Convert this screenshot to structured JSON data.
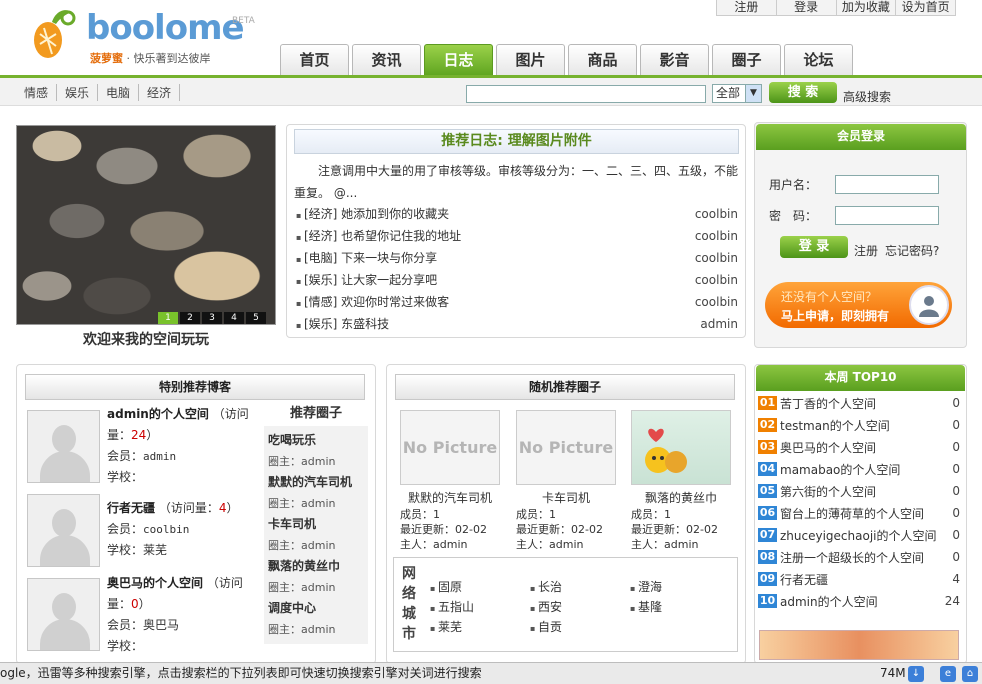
{
  "brand": {
    "name": "boolome",
    "beta": "BETA",
    "slogan_name": "菠萝蜜",
    "slogan_rest": " · 快乐著到达彼岸"
  },
  "toplinks": [
    "注册",
    "登录",
    "加为收藏",
    "设为首页"
  ],
  "tabs": [
    "首页",
    "资讯",
    "日志",
    "图片",
    "商品",
    "影音",
    "圈子",
    "论坛"
  ],
  "active_tab": "日志",
  "subnav": [
    "情感",
    "娱乐",
    "电脑",
    "经济"
  ],
  "search": {
    "select_value": "全部",
    "button": "搜 索",
    "advanced": "高级搜索"
  },
  "slideshow": {
    "pages": [
      "1",
      "2",
      "3",
      "4",
      "5"
    ],
    "active": "1",
    "caption": "欢迎来我的空间玩玩"
  },
  "recommend": {
    "title": "推荐日志: 理解图片附件",
    "body": "注意调用中大量的用了审核等级。审核等级分为：一、二、三、四、五级，不能重复。  @...",
    "items": [
      {
        "title": "[经济] 她添加到你的收藏夹",
        "author": "coolbin"
      },
      {
        "title": "[经济] 也希望你记住我的地址",
        "author": "coolbin"
      },
      {
        "title": "[电脑] 下来一块与你分享",
        "author": "coolbin"
      },
      {
        "title": "[娱乐] 让大家一起分享吧",
        "author": "coolbin"
      },
      {
        "title": "[情感] 欢迎你时常过来做客",
        "author": "coolbin"
      },
      {
        "title": "[娱乐] 东盛科技",
        "author": "admin"
      }
    ]
  },
  "login": {
    "title": "会员登录",
    "username_label": "用户名：",
    "password_label": "密　码：",
    "button": "登 录",
    "register": "注册",
    "forgot": "忘记密码?"
  },
  "promo": {
    "line1": "还没有个人空间？",
    "line2": "马上申请，即刻拥有"
  },
  "blogs": {
    "title": "特别推荐博客",
    "items": [
      {
        "name": "admin的个人空间",
        "visits_label": "（访问量：",
        "visits": "24",
        "member_label": "会员：",
        "member": "admin",
        "school_label": "学校：",
        "school": ""
      },
      {
        "name": "行者无疆",
        "visits_label": "（访问量：",
        "visits": "4",
        "member_label": "会员：",
        "member": "coolbin",
        "school_label": "学校：",
        "school": "莱芜"
      },
      {
        "name": "奥巴马的个人空间",
        "visits_label": "（访问量：",
        "visits": "0",
        "member_label": "会员：",
        "member": "奥巴马",
        "school_label": "学校：",
        "school": ""
      }
    ]
  },
  "circles_side": {
    "title": "推荐圈子",
    "items": [
      {
        "name": "吃喝玩乐",
        "owner": "圈主：admin"
      },
      {
        "name": "默默的汽车司机",
        "owner": "圈主：admin"
      },
      {
        "name": "卡车司机",
        "owner": "圈主：admin"
      },
      {
        "name": "飘落的黄丝巾",
        "owner": "圈主：admin"
      },
      {
        "name": "调度中心",
        "owner": "圈主：admin"
      }
    ]
  },
  "random_circles": {
    "title": "随机推荐圈子",
    "items": [
      {
        "pic": "No Picture",
        "name": "默默的汽车司机",
        "members": "成员：1",
        "updated": "最近更新：02-02",
        "owner": "主人：admin"
      },
      {
        "pic": "No Picture",
        "name": "卡车司机",
        "members": "成员：1",
        "updated": "最近更新：02-02",
        "owner": "主人：admin"
      },
      {
        "pic": "",
        "name": "飘落的黄丝巾",
        "members": "成员：1",
        "updated": "最近更新：02-02",
        "owner": "主人：admin"
      }
    ]
  },
  "cities": {
    "label": "网络城市",
    "items": [
      "固原",
      "长治",
      "澄海",
      "五指山",
      "西安",
      "基隆",
      "莱芜",
      "自贡"
    ]
  },
  "top10": {
    "title": "本周 TOP10",
    "items": [
      {
        "rank": "01",
        "name": "苦丁香的个人空间",
        "count": "0",
        "color": "#f08000"
      },
      {
        "rank": "02",
        "name": "testman的个人空间",
        "count": "0",
        "color": "#f08000"
      },
      {
        "rank": "03",
        "name": "奥巴马的个人空间",
        "count": "0",
        "color": "#f08000"
      },
      {
        "rank": "04",
        "name": "mamabao的个人空间",
        "count": "0",
        "color": "#2f86d6"
      },
      {
        "rank": "05",
        "name": "第六街的个人空间",
        "count": "0",
        "color": "#2f86d6"
      },
      {
        "rank": "06",
        "name": "窗台上的薄荷草的个人空间",
        "count": "0",
        "color": "#2f86d6"
      },
      {
        "rank": "07",
        "name": "zhuceyigechaoji的个人空间",
        "count": "0",
        "color": "#2f86d6"
      },
      {
        "rank": "08",
        "name": "注册一个超级长的个人空间",
        "count": "0",
        "color": "#2f86d6"
      },
      {
        "rank": "09",
        "name": "行者无疆",
        "count": "4",
        "color": "#2f86d6"
      },
      {
        "rank": "10",
        "name": "admin的个人空间",
        "count": "24",
        "color": "#2f86d6"
      }
    ]
  },
  "status": {
    "message": "ogle，迅雷等多种搜索引擎，点击搜索栏的下拉列表即可快速切换搜索引擎对关词进行搜索",
    "zoom": "74M"
  }
}
